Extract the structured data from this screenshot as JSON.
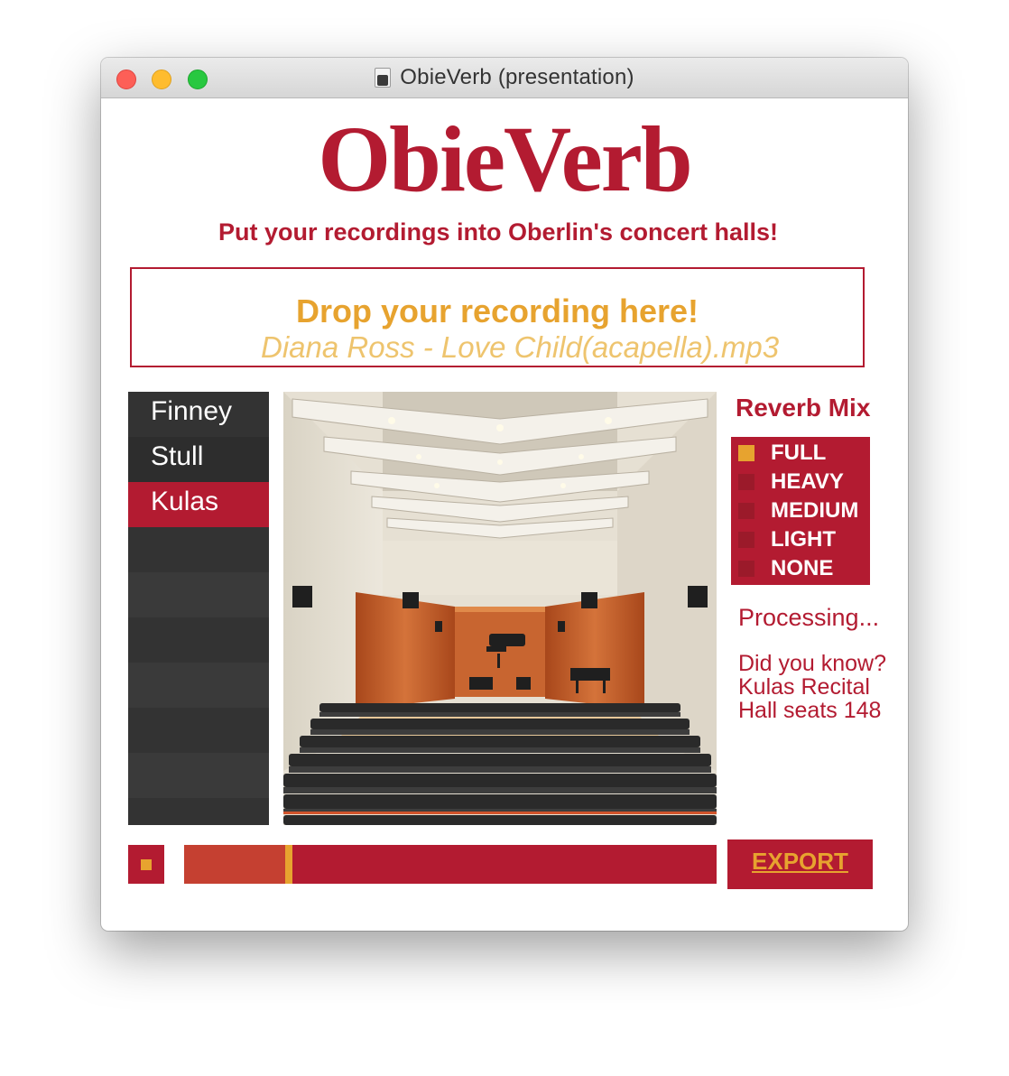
{
  "window": {
    "title": "ObieVerb (presentation)"
  },
  "app": {
    "logo": "ObieVerb",
    "tagline": "Put your recordings into Oberlin's concert halls!"
  },
  "drop_zone": {
    "title": "Drop your recording here!",
    "filename": "Diana Ross - Love Child(acapella).mp3"
  },
  "halls": {
    "items": [
      {
        "label": "Finney",
        "selected": false
      },
      {
        "label": "Stull",
        "selected": false
      },
      {
        "label": "Kulas",
        "selected": true
      }
    ]
  },
  "reverb": {
    "title": "Reverb Mix",
    "options": [
      {
        "label": "FULL",
        "selected": true
      },
      {
        "label": "HEAVY",
        "selected": false
      },
      {
        "label": "MEDIUM",
        "selected": false
      },
      {
        "label": "LIGHT",
        "selected": false
      },
      {
        "label": "NONE",
        "selected": false
      }
    ]
  },
  "status": {
    "text": "Processing...",
    "fact": "Did you know? Kulas Recital Hall seats 148"
  },
  "transport": {
    "progress_fraction": 0.19,
    "export_label": "EXPORT"
  },
  "colors": {
    "brand_red": "#b31b31",
    "accent_gold": "#e7a32f",
    "list_dark": "#333333"
  }
}
